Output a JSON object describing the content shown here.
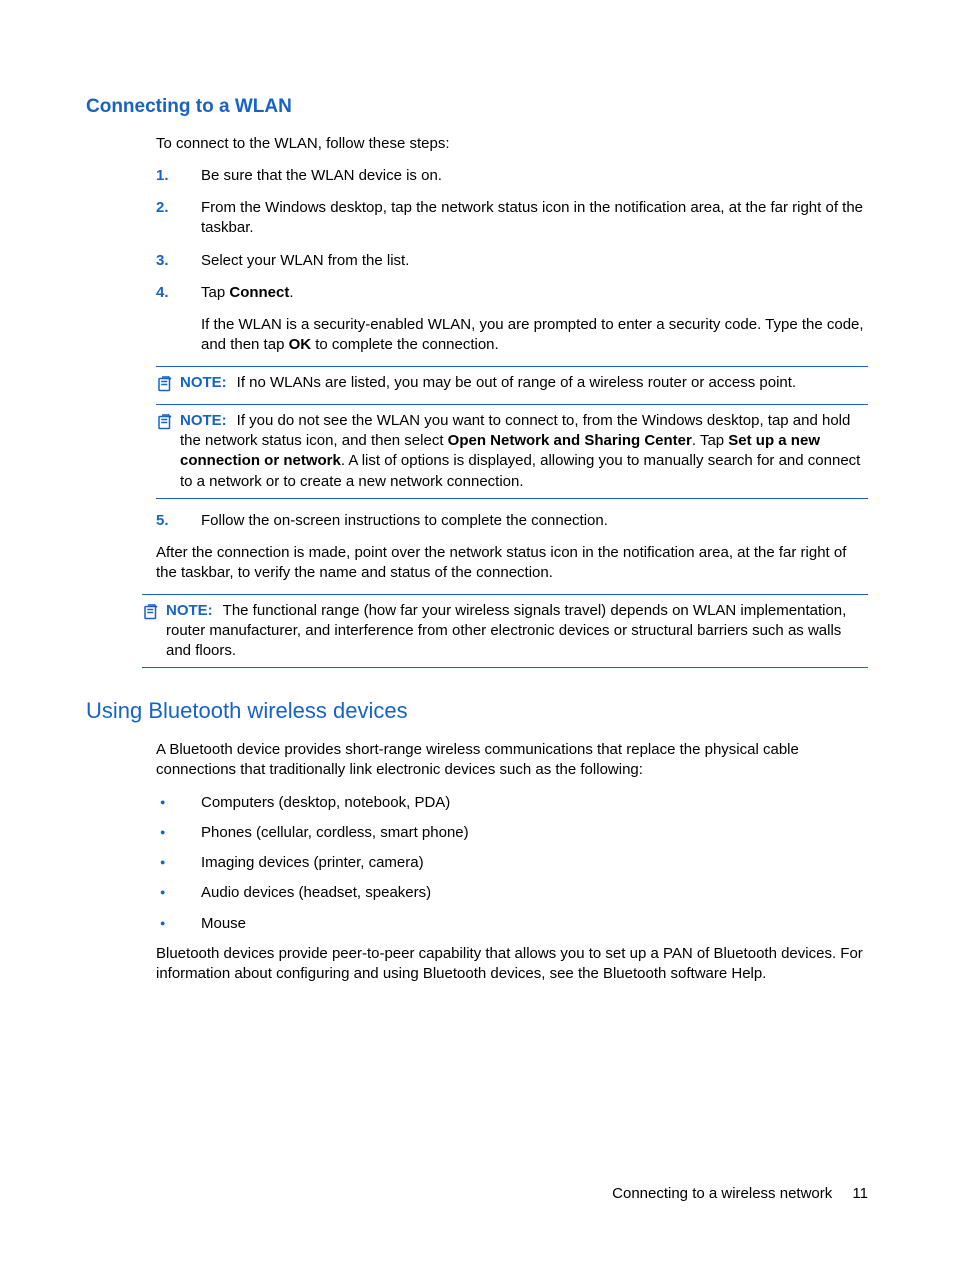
{
  "section1": {
    "heading": "Connecting to a WLAN",
    "intro": "To connect to the WLAN, follow these steps:",
    "steps": [
      {
        "num": "1.",
        "text": "Be sure that the WLAN device is on."
      },
      {
        "num": "2.",
        "text": "From the Windows desktop, tap the network status icon in the notification area, at the far right of the taskbar."
      },
      {
        "num": "3.",
        "text": "Select your WLAN from the list."
      },
      {
        "num": "4.",
        "text_prefix": "Tap ",
        "text_bold": "Connect",
        "text_suffix": ".",
        "sub_prefix": "If the WLAN is a security-enabled WLAN, you are prompted to enter a security code. Type the code, and then tap ",
        "sub_bold": "OK",
        "sub_suffix": " to complete the connection.",
        "notes": [
          {
            "label": "NOTE:",
            "text": "If no WLANs are listed, you may be out of range of a wireless router or access point."
          },
          {
            "label": "NOTE:",
            "text_prefix": "If you do not see the WLAN you want to connect to, from the Windows desktop, tap and hold the network status icon, and then select ",
            "bold1": "Open Network and Sharing Center",
            "mid": ". Tap ",
            "bold2": "Set up a new connection or network",
            "suffix": ". A list of options is displayed, allowing you to manually search for and connect to a network or to create a new network connection."
          }
        ]
      },
      {
        "num": "5.",
        "text": "Follow the on-screen instructions to complete the connection."
      }
    ],
    "after": "After the connection is made, point over the network status icon in the notification area, at the far right of the taskbar, to verify the name and status of the connection.",
    "bottom_note": {
      "label": "NOTE:",
      "text": "The functional range (how far your wireless signals travel) depends on WLAN implementation, router manufacturer, and interference from other electronic devices or structural barriers such as walls and floors."
    }
  },
  "section2": {
    "heading": "Using Bluetooth wireless devices",
    "intro": "A Bluetooth device provides short-range wireless communications that replace the physical cable connections that traditionally link electronic devices such as the following:",
    "bullets": [
      "Computers (desktop, notebook, PDA)",
      "Phones (cellular, cordless, smart phone)",
      "Imaging devices (printer, camera)",
      "Audio devices (headset, speakers)",
      "Mouse"
    ],
    "after": "Bluetooth devices provide peer-to-peer capability that allows you to set up a PAN of Bluetooth devices. For information about configuring and using Bluetooth devices, see the Bluetooth software Help."
  },
  "footer": {
    "text": "Connecting to a wireless network",
    "page": "11"
  }
}
